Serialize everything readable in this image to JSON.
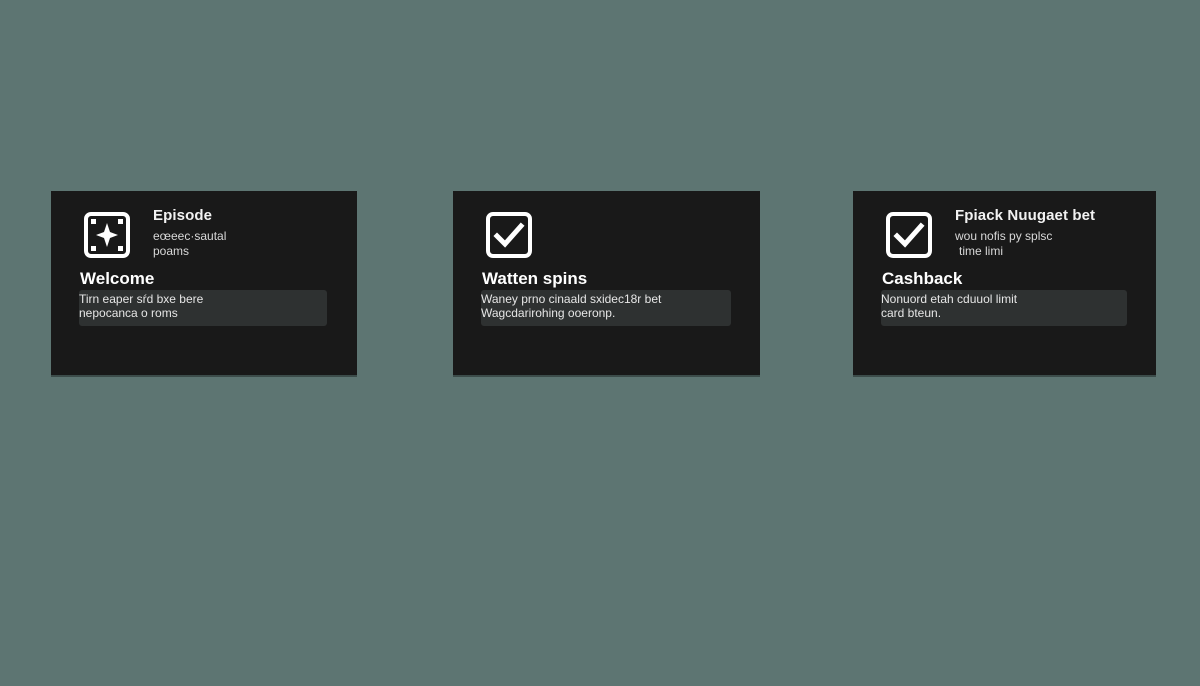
{
  "cards": [
    {
      "icon": "sparkle-icon",
      "title": "Episode",
      "subtitle_lines": [
        "eœeec·sautal",
        "poams"
      ],
      "heading": "Welcome",
      "desc_lines": [
        "Tirn eaper sŕd bxe bere",
        "nepocanca o roms"
      ]
    },
    {
      "icon": "checkbox-checked-icon",
      "title": "",
      "subtitle_lines": [],
      "heading": "Watten spins",
      "desc_lines": [
        "Waney prno cinaald sxidec18r bet",
        "Wagcdarirohing ooeronp."
      ]
    },
    {
      "icon": "checkbox-checked-icon",
      "title": "Fpiack Nuugaet bet",
      "subtitle_lines": [
        "wou nofis py splsc",
        "time limi"
      ],
      "heading": "Cashback",
      "desc_lines": [
        "Nonuord etah cduuol limit",
        "card bteun."
      ]
    }
  ],
  "colors": {
    "background": "#5d7572",
    "card": "#191919",
    "desc_box": "#2e3131",
    "text": "#ffffff"
  }
}
